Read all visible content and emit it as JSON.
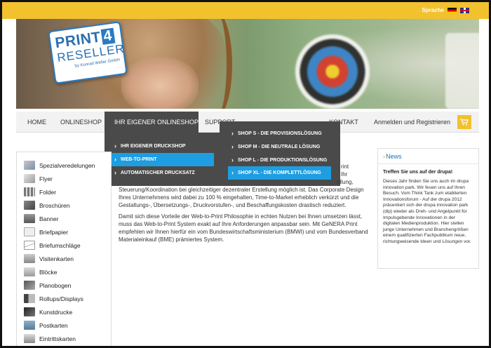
{
  "header": {
    "language_label": "Sprache",
    "flags": [
      "flag-de-icon",
      "flag-uk-icon"
    ],
    "logo": {
      "line1": "PRINT",
      "digit": "4",
      "line2": "RESELLER",
      "sub": "by Konrad Weiler GmbH"
    }
  },
  "nav": {
    "items": [
      {
        "label": "HOME"
      },
      {
        "label": "ONLINESHOP"
      },
      {
        "label": "IHR EIGENER ONLINESHOP",
        "active": true
      },
      {
        "label": "SUPPORT"
      },
      {
        "label": "KONTAKT"
      }
    ],
    "login_label": "Anmelden und Registrieren",
    "cart_icon": "cart-icon"
  },
  "dropdown": {
    "col1": [
      {
        "label": "IHR EIGENER DRUCKSHOP",
        "highlighted": false
      },
      {
        "label": "WEB-TO-PRINT",
        "highlighted": true
      },
      {
        "label": "AUTOMATISCHER DRUCKSATZ",
        "highlighted": false
      }
    ],
    "col2": [
      {
        "label": "SHOP S - DIE PROVISIONSLÖSUNG",
        "highlighted": false
      },
      {
        "label": "SHOP M - DIE NEUTRALE LÖSUNG",
        "highlighted": false
      },
      {
        "label": "SHOP L - DIE PRODUKTIONSLÖSUNG",
        "highlighted": false
      },
      {
        "label": "SHOP XL - DIE KOMPLETTLÖSUNG",
        "highlighted": true
      }
    ]
  },
  "sidebar": {
    "items": [
      {
        "label": "Spezialveredelungen"
      },
      {
        "label": "Flyer"
      },
      {
        "label": "Folder"
      },
      {
        "label": "Broschüren"
      },
      {
        "label": "Banner"
      },
      {
        "label": "Briefpapier"
      },
      {
        "label": "Briefumschläge"
      },
      {
        "label": "Visitenkarten"
      },
      {
        "label": "Blöcke"
      },
      {
        "label": "Planobogen"
      },
      {
        "label": "Rollups/Displays"
      },
      {
        "label": "Kunstdrucke"
      },
      {
        "label": "Postkarten"
      },
      {
        "label": "Eintrittskarten"
      }
    ]
  },
  "content": {
    "partial_right_1": "rint",
    "partial_right_2": "Ihr",
    "partial_right_3": "ellung,",
    "paragraph1": "Steuerung/Koordination bei gleichzeitiger dezentraler Erstellung möglich ist. Das Corporate Design Ihres Unternehmens wird dabei zu 100 % eingehalten, Time-to-Market erheblich verkürzt und die Gestaltungs-, Übersetzungs-, Druckvorstufen-, und Beschaffungskosten drastisch reduziert.",
    "paragraph2": "Damit sich diese Vorteile der Web-to-Print Philosophie in echten Nutzen bei Ihnen umsetzen lässt, muss das Web-to-Print System exakt auf Ihre Anforderungen anpassbar sein. Mit GeNERA Print empfehlen wir Ihnen hierfür ein vom Bundeswirtschaftsministerium (BMWI) und vom Bundesverband Materialeinkauf (BME) prämiertes System."
  },
  "news": {
    "title": "News",
    "headline": "Treffen Sie uns auf der drupa!",
    "body": "Dieses Jahr finden Sie uns auch im drupa innovation park. Wir feuen uns auf Ihren Besuch. Vom Think Tank zum etablierten Innovationsforum - Auf der drupa 2012 präsentiert sich der drupa innovation park (dip) wieder als Dreh- und Angelpunkt für Impulsgebende Innovationen in der digitalen Medienproduktion. Hier stellen junge Unternehmen und Branchengrößen einem qualifizierten Fachpublikum neue, richtungweisende Ideen und Lösungen vor."
  },
  "colors": {
    "accent": "#f2c12e",
    "nav_active": "#4a4a4a",
    "highlight": "#1e9ee0",
    "link": "#1e6fb8"
  }
}
